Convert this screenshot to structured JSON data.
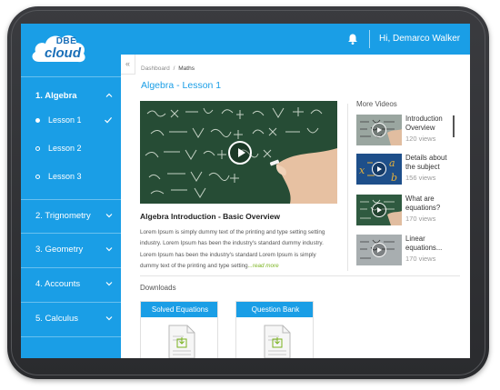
{
  "brand": {
    "logo_top": "DBE",
    "logo_bottom": "cloud"
  },
  "header": {
    "greeting": "Hi, Demarco Walker"
  },
  "sidebar": {
    "sections": [
      {
        "label": "1. Algebra",
        "state": "expanded"
      },
      {
        "label": "2. Trignometry"
      },
      {
        "label": "3. Geometry"
      },
      {
        "label": "4. Accounts"
      },
      {
        "label": "5. Calculus"
      }
    ],
    "lessons": [
      {
        "label": "Lesson 1",
        "completed": true,
        "current": true
      },
      {
        "label": "Lesson 2"
      },
      {
        "label": "Lesson 3"
      }
    ]
  },
  "collapse_icon": "«",
  "breadcrumb": {
    "root": "Dashboard",
    "separator": "/",
    "current": "Maths"
  },
  "page_title": "Algebra - Lesson 1",
  "video": {
    "title": "Algebra Introduction - Basic Overview",
    "description": "Lorem Ipsum is simply dummy text of the printing and type setting setting industry. Lorem Ipsum has been the industry's standard dummy industry. Lorem Ipsum has been the industry's standard Lorem Ipsum is simply dummy text of the printing and type setting",
    "read_more": "...read more"
  },
  "more_videos": {
    "title": "More Videos",
    "items": [
      {
        "title": "Introduction Overview",
        "views": "120 views"
      },
      {
        "title": "Details about the subject",
        "views": "156 views"
      },
      {
        "title": "What are equations?",
        "views": "170 views"
      },
      {
        "title": "Linear equations...",
        "views": "170 views"
      }
    ]
  },
  "downloads": {
    "title": "Downloads",
    "items": [
      {
        "label": "Solved Equations",
        "icon": "download-document-icon"
      },
      {
        "label": "Question Bank",
        "icon": "download-document-icon"
      }
    ]
  },
  "colors": {
    "primary": "#1a9ee6",
    "link_green": "#7ab31f",
    "text_dark": "#222222"
  }
}
